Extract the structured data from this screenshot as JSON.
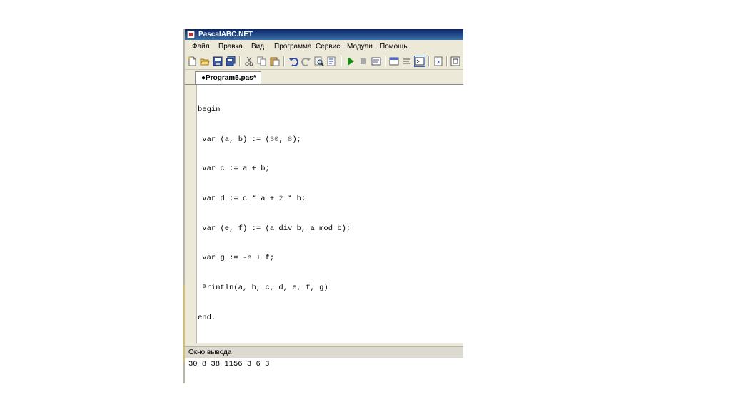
{
  "window": {
    "title": "PascalABC.NET"
  },
  "menu": [
    "Файл",
    "Правка",
    "Вид",
    "Программа",
    "Сервис",
    "Модули",
    "Помощь"
  ],
  "toolbar": {
    "icons": [
      "new-file-icon",
      "open-folder-icon",
      "save-icon",
      "save-all-icon",
      "cut-icon",
      "copy-icon",
      "paste-icon",
      "undo-icon",
      "redo-icon",
      "find-icon",
      "replace-icon",
      "run-icon",
      "stop-icon",
      "debug-icon",
      "output-window-icon",
      "comment-icon",
      "console-icon",
      "format-icon",
      "compile-icon"
    ]
  },
  "tab": {
    "label": "●Program5.pas*"
  },
  "code": {
    "lines": [
      "begin",
      " var (a, b) := (30, 8);",
      " var c := a + b;",
      " var d := c * a + 2 * b;",
      " var (e, f) := (a div b, a mod b);",
      " var g := -e + f;",
      " Println(a, b, c, d, e, f, g)",
      "end."
    ]
  },
  "output_panel": {
    "title": "Окно вывода",
    "text": "30 8 38 1156 3 6 3"
  },
  "colors": {
    "title_bar": "#0a246a",
    "chrome": "#ece9d8",
    "run_icon": "#1a8a1a"
  }
}
